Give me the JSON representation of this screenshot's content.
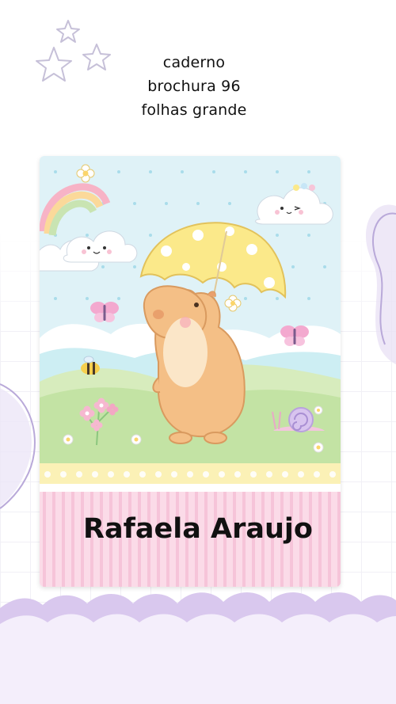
{
  "title": {
    "lines": [
      "caderno",
      "brochura 96",
      "folhas grande"
    ]
  },
  "cover": {
    "name": "Rafaela Araujo"
  },
  "colors": {
    "background": "#ffffff",
    "sky": "#dff2f7",
    "hill": "#cfe9b4",
    "pink_stripes": "#f6c9dc",
    "yellow_band": "#fbf1b6",
    "capybara": "#f4bf86",
    "umbrella": "#fbe98a",
    "lavender_wave": "#d7c7ec",
    "lavender_bottom": "#f4eefb"
  },
  "icons": [
    "star-outline-icon",
    "rainbow-icon",
    "cloud-icon",
    "umbrella-icon",
    "capybara-icon",
    "butterfly-icon",
    "bee-icon",
    "snail-icon",
    "flower-icon"
  ]
}
